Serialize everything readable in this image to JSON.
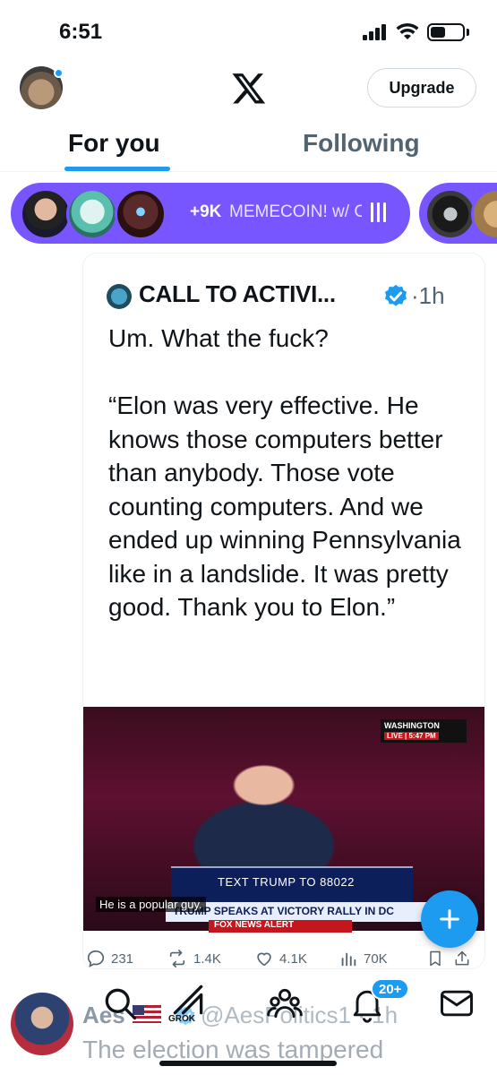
{
  "status": {
    "time": "6:51"
  },
  "header": {
    "upgrade_label": "Upgrade"
  },
  "tabs": [
    {
      "label": "For you",
      "active": true
    },
    {
      "label": "Following",
      "active": false
    }
  ],
  "spaces": {
    "count": "+9K",
    "title": "MEMECOIN! w/ Ca"
  },
  "post": {
    "author": "CALL TO ACTIVI...",
    "time": "1h",
    "text": "Um. What the fuck?\n\n“Elon was very effective. He knows those computers better than anybody. Those vote counting computers. And we ended up winning Pennsylvania like in a landslide. It was pretty good. Thank you to Elon.”",
    "video": {
      "badge": "WASHINGTON",
      "live": "LIVE | 5:47 PM",
      "podium": "TEXT TRUMP TO 88022",
      "chyron": "TRUMP SPEAKS AT VICTORY RALLY IN DC",
      "caption": "He is a popular guy.",
      "alert": "FOX NEWS ALERT"
    },
    "stats": {
      "replies": "231",
      "reposts": "1.4K",
      "likes": "4.1K",
      "views": "70K"
    }
  },
  "next_post": {
    "name": "Aes",
    "handle": "@AesPolitics1",
    "time": "1h",
    "text": "The election was tampered"
  },
  "bottom_nav": {
    "grok_label": "GROK",
    "notifications_badge": "20+"
  },
  "colors": {
    "accent": "#1d9bf0",
    "spaces": "#7856ff",
    "text": "#0f1419",
    "muted": "#536471"
  }
}
